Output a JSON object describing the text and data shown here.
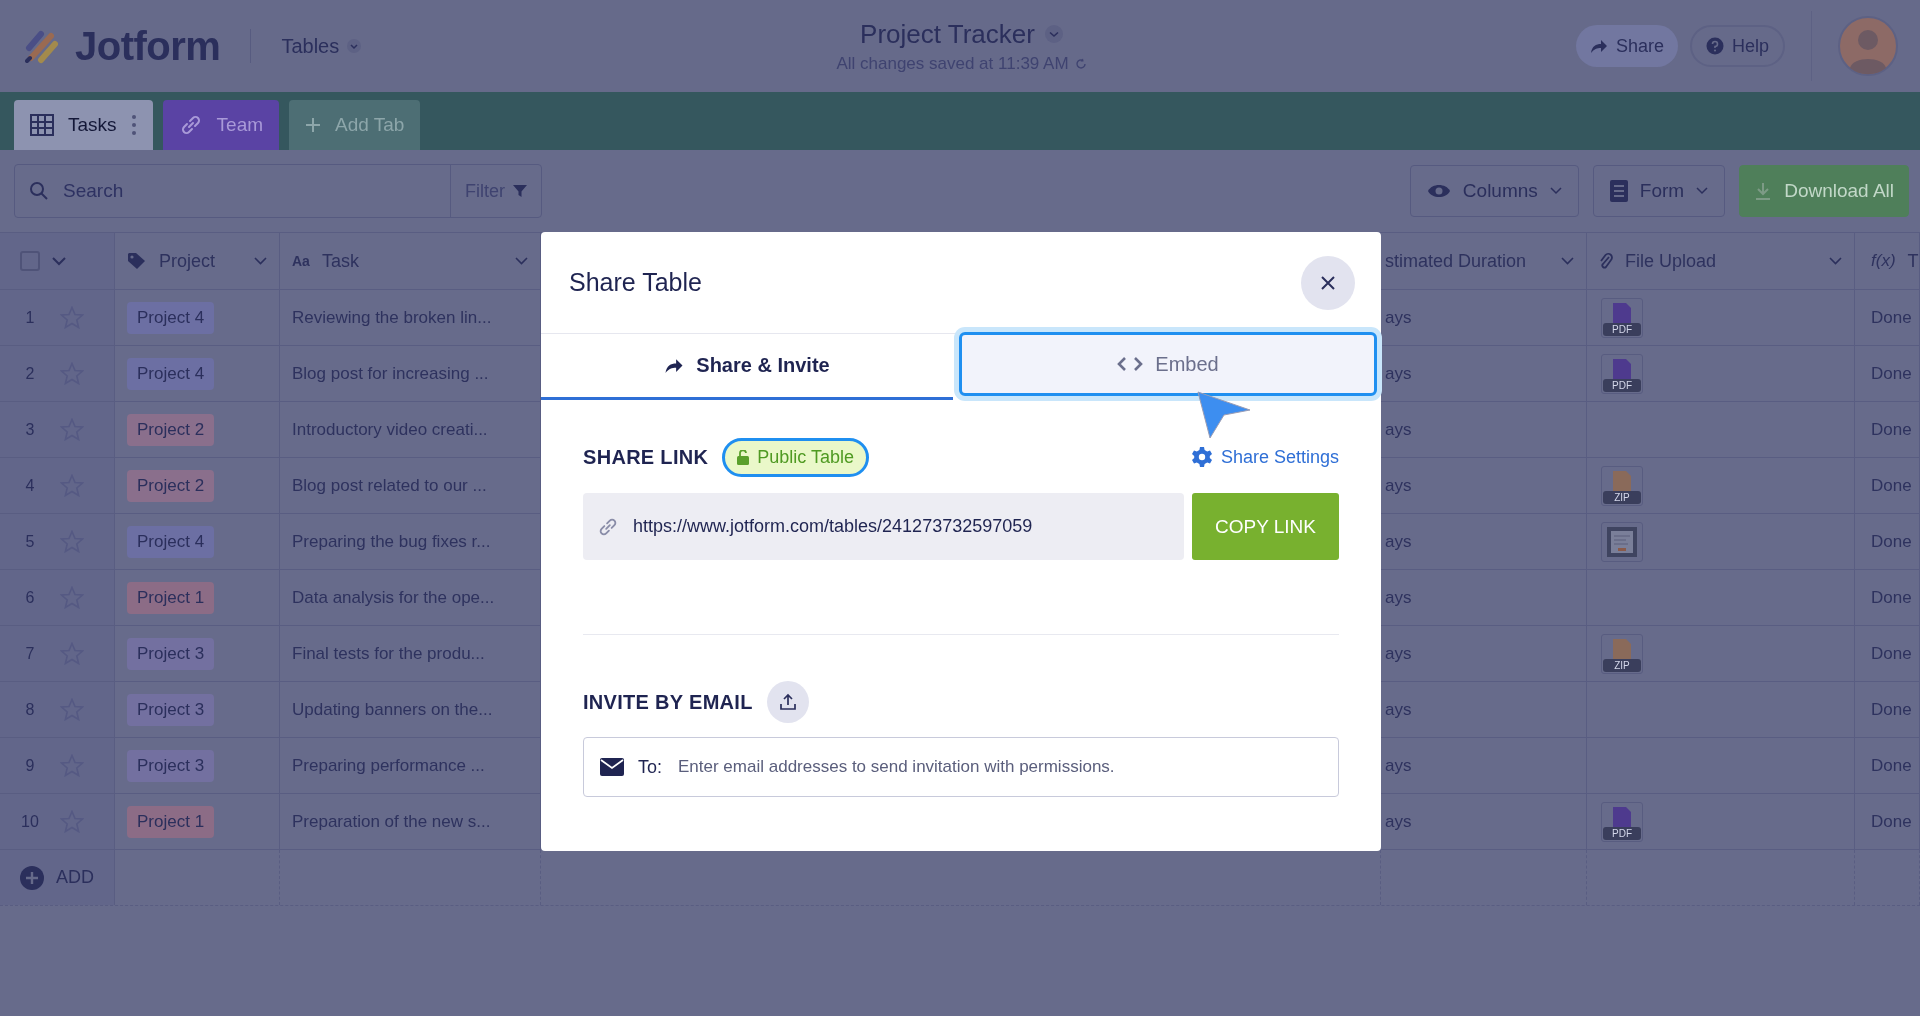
{
  "app": {
    "logo": "Jotform",
    "section": "Tables"
  },
  "document": {
    "title": "Project Tracker",
    "status": "All changes saved at 11:39 AM"
  },
  "header_buttons": [
    {
      "kind": "share",
      "label": "Share"
    },
    {
      "kind": "help",
      "label": "Help"
    }
  ],
  "tabs": [
    {
      "kind": "table",
      "label": "Tasks",
      "selected": true
    },
    {
      "kind": "link",
      "label": "Team",
      "selected": false
    },
    {
      "kind": "add",
      "label": "Add Tab",
      "selected": false
    }
  ],
  "toolbar": {
    "search_placeholder": "Search",
    "filter": "Filter",
    "buttons": [
      {
        "kind": "columns",
        "label": "Columns"
      },
      {
        "kind": "form",
        "label": "Form"
      },
      {
        "kind": "download",
        "label": "Download All"
      }
    ]
  },
  "table": {
    "select_all_checked": false,
    "add_label": "ADD",
    "columns": [
      {
        "kind": "tag",
        "label": "Project"
      },
      {
        "kind": "text",
        "type_label": "Aa",
        "label": "Task"
      },
      {
        "kind": "duration",
        "label": "stimated Duration"
      },
      {
        "kind": "file",
        "label": "File Upload"
      },
      {
        "kind": "formula",
        "type_label": "f(x)",
        "label": "T"
      }
    ],
    "rows": [
      {
        "number": "1",
        "starred": false,
        "project": {
          "label": "Project 4",
          "color": "#6c6fa3"
        },
        "task": "Reviewing the broken lin...",
        "duration": "ays",
        "file": {
          "kind": "pdf",
          "label": "PDF"
        },
        "formula": "Done"
      },
      {
        "number": "2",
        "starred": false,
        "project": {
          "label": "Project 4",
          "color": "#6c6fa3"
        },
        "task": "Blog post for increasing ...",
        "duration": "ays",
        "file": {
          "kind": "pdf",
          "label": "PDF"
        },
        "formula": "Done"
      },
      {
        "number": "3",
        "starred": false,
        "project": {
          "label": "Project 2",
          "color": "#8a6f8c"
        },
        "task": "Introductory video creati...",
        "duration": "ays",
        "formula": "Done"
      },
      {
        "number": "4",
        "starred": false,
        "project": {
          "label": "Project 2",
          "color": "#8a6f8c"
        },
        "task": "Blog post related to our ...",
        "duration": "ays",
        "file": {
          "kind": "zip",
          "label": "ZIP"
        },
        "formula": "Done"
      },
      {
        "number": "5",
        "starred": false,
        "project": {
          "label": "Project 4",
          "color": "#6c6fa3"
        },
        "task": "Preparing the bug fixes r...",
        "duration": "ays",
        "file": {
          "kind": "image"
        },
        "formula": "Done"
      },
      {
        "number": "6",
        "starred": false,
        "project": {
          "label": "Project 1",
          "color": "#8c6c86"
        },
        "task": "Data analysis for the ope...",
        "duration": "ays",
        "formula": "Done"
      },
      {
        "number": "7",
        "starred": false,
        "project": {
          "label": "Project 3",
          "color": "#7370a0"
        },
        "task": "Final tests for the produ...",
        "duration": "ays",
        "file": {
          "kind": "zip",
          "label": "ZIP"
        },
        "formula": "Done"
      },
      {
        "number": "8",
        "starred": false,
        "project": {
          "label": "Project 3",
          "color": "#7370a0"
        },
        "task": "Updating banners on the...",
        "duration": "ays",
        "formula": "Done"
      },
      {
        "number": "9",
        "starred": false,
        "project": {
          "label": "Project 3",
          "color": "#7370a0"
        },
        "task": "Preparing performance ...",
        "duration": "ays",
        "formula": "Done"
      },
      {
        "number": "10",
        "starred": false,
        "project": {
          "label": "Project 1",
          "color": "#8c6c86"
        },
        "task": "Preparation of the new s...",
        "duration": "ays",
        "file": {
          "kind": "pdf",
          "label": "PDF"
        },
        "formula": "Done"
      }
    ]
  },
  "modal": {
    "title": "Share Table",
    "tabs": [
      {
        "kind": "share",
        "label": "Share & Invite",
        "selected": true,
        "highlighted": false
      },
      {
        "kind": "embed",
        "label": "Embed",
        "selected": false,
        "highlighted": true
      }
    ],
    "share_link": {
      "heading": "SHARE LINK",
      "badge": "Public Table",
      "settings": "Share Settings",
      "url": "https://www.jotform.com/tables/241273732597059",
      "copy": "COPY LINK"
    },
    "invite": {
      "heading": "INVITE BY EMAIL",
      "to_label": "To:",
      "placeholder": "Enter email addresses to send invitation with permissions."
    }
  }
}
